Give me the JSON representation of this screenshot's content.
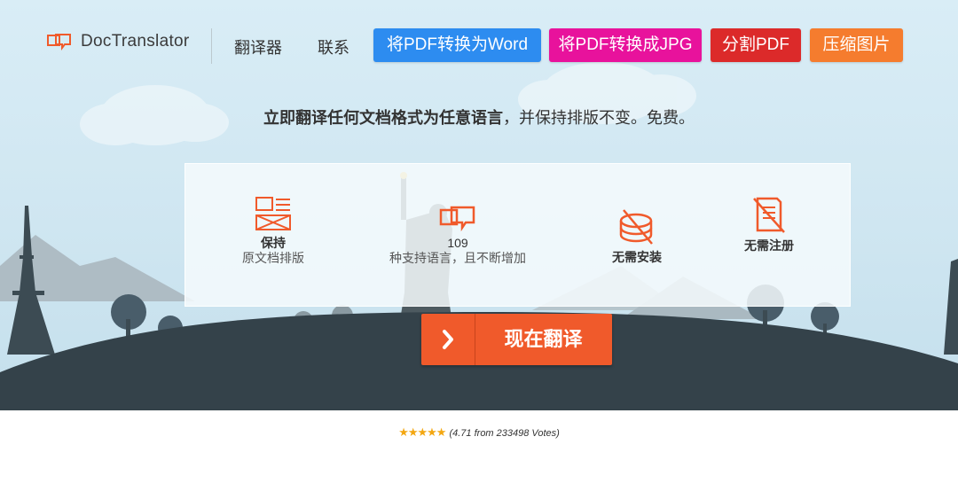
{
  "header": {
    "logo_text": "DocTranslator",
    "nav": {
      "translator": "翻译器",
      "contact": "联系"
    },
    "buttons": {
      "pdf_to_word": "将PDF转换为Word",
      "pdf_to_jpg": "将PDF转换成JPG",
      "split_pdf": "分割PDF",
      "compress_image": "压缩图片"
    }
  },
  "tagline": {
    "bold": "立即翻译任何文档格式为任意语言",
    "rest": "，并保持排版不变。免费。"
  },
  "features": [
    {
      "title": "保持",
      "subtitle": "原文档排版"
    },
    {
      "title": "109",
      "subtitle": "种支持语言，且不断增加"
    },
    {
      "title": "无需安装",
      "subtitle": ""
    },
    {
      "title": "无需注册",
      "subtitle": ""
    }
  ],
  "cta": {
    "arrow": "›",
    "label": "现在翻译"
  },
  "rating": {
    "stars": "★★★★★",
    "text": "(4.71 from 233498 Votes)",
    "value": 4.71
  },
  "colors": {
    "pdf_to_word": "#2d8cf0",
    "pdf_to_jpg": "#e8129c",
    "split_pdf": "#dc2a2a",
    "compress_image": "#f57c2e",
    "accent": "#f05a2b",
    "hill": "#34424a"
  }
}
